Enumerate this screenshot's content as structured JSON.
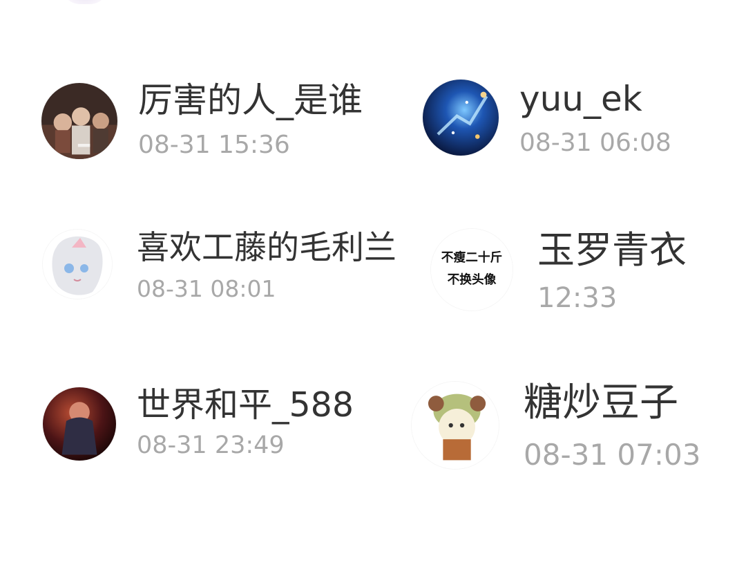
{
  "users": [
    {
      "name": "厉害的人_是谁",
      "time": "08-31 15:36",
      "avatar_icon": "avatar-photo-group"
    },
    {
      "name": "yuu_ek",
      "time": "08-31 06:08",
      "avatar_icon": "avatar-blue-nebula"
    },
    {
      "name": "喜欢工藤的毛利兰",
      "time": "08-31 08:01",
      "avatar_icon": "avatar-anime-girl"
    },
    {
      "name": "玉罗青衣",
      "time": "12:33",
      "avatar_icon": "avatar-text-badge",
      "avatar_text": [
        "不瘦二十斤",
        "不换头像"
      ]
    },
    {
      "name": "世界和平_588",
      "time": "08-31 23:49",
      "avatar_icon": "avatar-red-portrait"
    },
    {
      "name": "糖炒豆子",
      "time": "08-31 07:03",
      "avatar_icon": "avatar-cartoon-character"
    }
  ]
}
